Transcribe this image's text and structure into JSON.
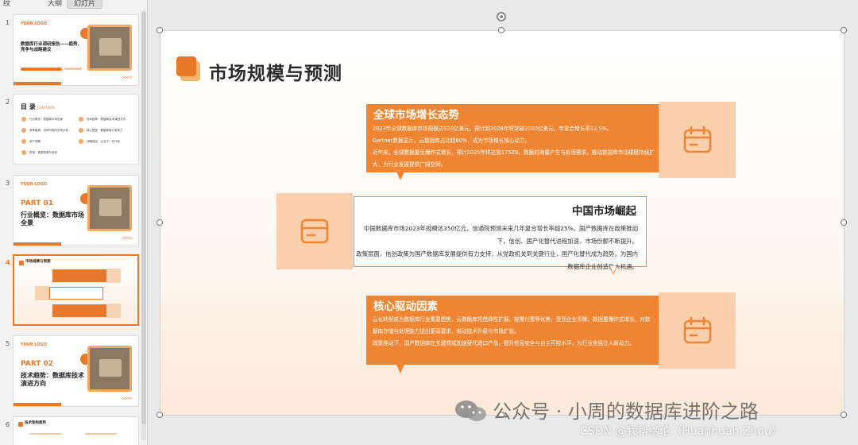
{
  "panel": {
    "tab_edge": "纹",
    "tab_outline": "大纲",
    "tab_slides": "幻灯片",
    "thumbnails": [
      {
        "number": "1",
        "logo": "YOUR LOGO",
        "title": "数据库行业调研报告——趋势、竞争与战略建议",
        "arrows": ">>>>"
      },
      {
        "number": "2",
        "heading": "目 录",
        "heading_sub": "CONTENTS",
        "items": [
          "行业概览：数据库市场全景",
          "技术趋势：数据库技术演进方向",
          "竞争格局：全球与国内市场分析",
          "核心壁垒：数据库核心竞争力",
          "用户洞察",
          "战略建议：企业下一步行动",
          "附录：数据来源与参考"
        ]
      },
      {
        "number": "3",
        "logo": "YOUR LOGO",
        "part": "PART 01",
        "title": "行业概览：数据库市场全景",
        "arrows": ">>>>"
      },
      {
        "number": "4",
        "title": "市场规模与预测"
      },
      {
        "number": "5",
        "logo": "YOUR LOGO",
        "part": "PART 02",
        "title": "技术趋势：数据库技术演进方向",
        "arrows": ">>>>"
      },
      {
        "number": "6",
        "title": "技术架构趋势"
      }
    ]
  },
  "slide": {
    "title": "市场规模与预测",
    "cards": [
      {
        "heading": "全球市场增长态势",
        "icon": "calendar-icon",
        "lines": [
          "2023年全球数据库市场规模达920亿美元，预计到2028年将突破2000亿美元，年复合增长率12.5%。",
          "Gartner数据显示，云数据库占比超60%，成为市场增长核心动力。",
          "近年来，全球数据量呈爆炸式增长，预计2025年将达到175ZB。数据的海量产生与处理需求，推动数据库市场规模持续扩大，为行业发展提供广阔空间。"
        ]
      },
      {
        "heading": "中国市场崛起",
        "icon": "credit-card-icon",
        "lines": [
          "中国数据库市场2023年规模达350亿元，信通院预测未来几年复合增长率超25%。国产数据库在政策推动下，信创、国产化替代进程加速，市场份额不断提升。",
          "政策层面，信创政策为国产数据库发展提供有力支持，从党政机关到关键行业，国产化替代成为趋势，为国内数据库企业创造巨大机遇。"
        ]
      },
      {
        "heading": "核心驱动因素",
        "icon": "calendar-icon",
        "lines": [
          "云化转型成为数据库行业重要趋势，云数据库凭借弹性扩展、按需付费等优势，受到企业青睐。数据量爆炸式增长，对数据库存储与处理能力提出更高要求，推动技术升级与市场扩张。",
          "政策推动下，国产数据库在关键领域加速替代进口产品，提升信息安全与自主可控水平，为行业发展注入新动力。"
        ]
      }
    ]
  },
  "watermark": {
    "main": "公众号 · 小周的数据库进阶之路",
    "csdn": "CSDN @我科绝伦（Huanhuan Zhou）"
  },
  "colors": {
    "accent": "#ef8532",
    "accent_light": "#f9cfac",
    "title": "#2a2a2a"
  }
}
